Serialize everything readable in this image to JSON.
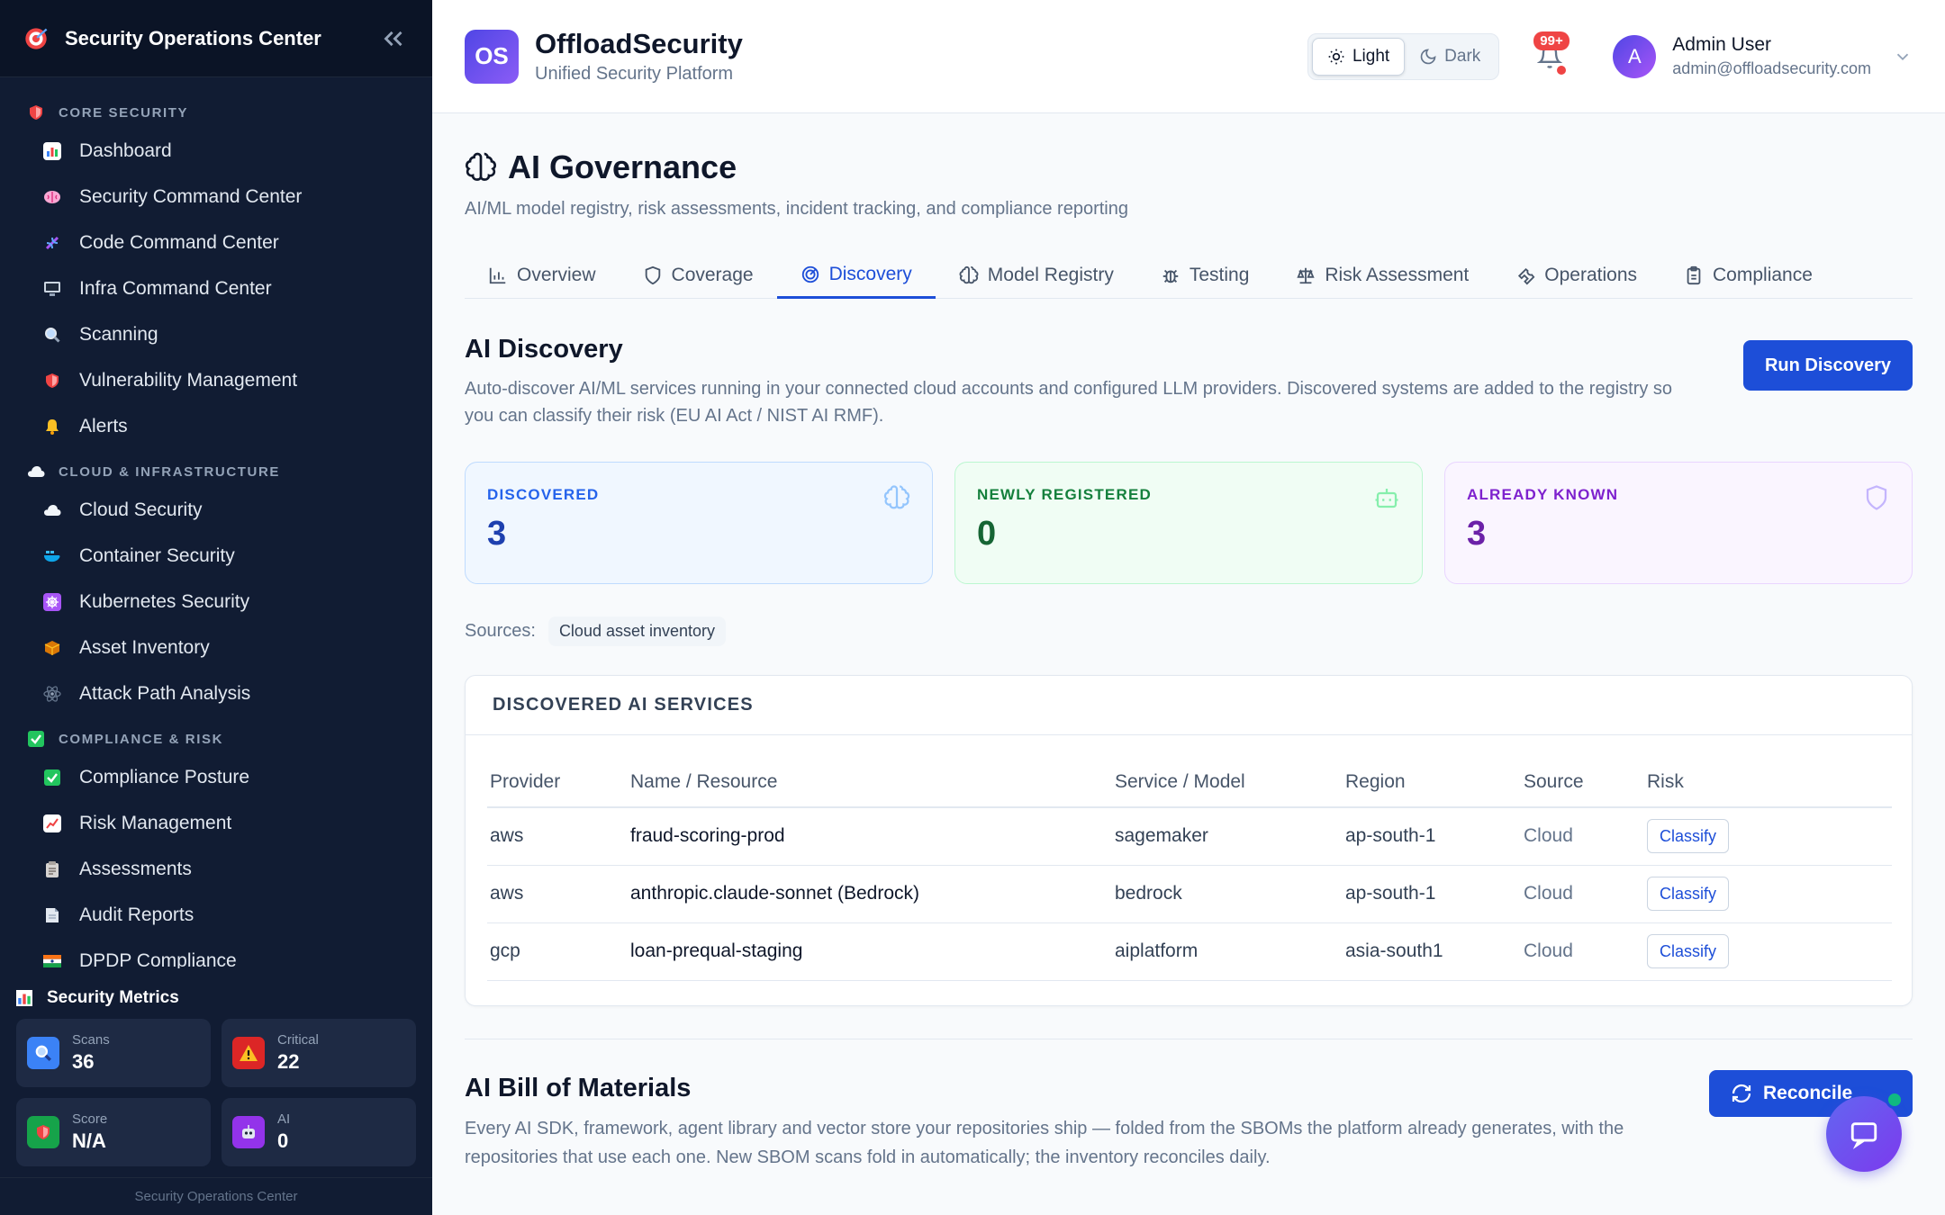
{
  "sidebar": {
    "title": "Security Operations Center",
    "sections": [
      {
        "label": "CORE SECURITY",
        "items": [
          "Dashboard",
          "Security Command Center",
          "Code Command Center",
          "Infra Command Center",
          "Scanning",
          "Vulnerability Management",
          "Alerts"
        ]
      },
      {
        "label": "CLOUD & INFRASTRUCTURE",
        "items": [
          "Cloud Security",
          "Container Security",
          "Kubernetes Security",
          "Asset Inventory",
          "Attack Path Analysis"
        ]
      },
      {
        "label": "COMPLIANCE & RISK",
        "items": [
          "Compliance Posture",
          "Risk Management",
          "Assessments",
          "Audit Reports",
          "DPDP Compliance"
        ]
      }
    ],
    "metrics": {
      "title": "Security Metrics",
      "cards": [
        {
          "label": "Scans",
          "value": "36"
        },
        {
          "label": "Critical",
          "value": "22"
        },
        {
          "label": "Score",
          "value": "N/A"
        },
        {
          "label": "AI",
          "value": "0"
        }
      ]
    },
    "footer": "Security Operations Center"
  },
  "header": {
    "logo": "OS",
    "brand": "OffloadSecurity",
    "subtitle": "Unified Security Platform",
    "theme": {
      "light": "Light",
      "dark": "Dark"
    },
    "notifications": "99+",
    "avatar": "A",
    "user_name": "Admin User",
    "user_email": "admin@offloadsecurity.com"
  },
  "page": {
    "title": "AI Governance",
    "description": "AI/ML model registry, risk assessments, incident tracking, and compliance reporting",
    "tabs": [
      "Overview",
      "Coverage",
      "Discovery",
      "Model Registry",
      "Testing",
      "Risk Assessment",
      "Operations",
      "Compliance"
    ],
    "active_tab": "Discovery"
  },
  "discovery": {
    "title": "AI Discovery",
    "description": "Auto-discover AI/ML services running in your connected cloud accounts and configured LLM providers. Discovered systems are added to the registry so you can classify their risk (EU AI Act / NIST AI RMF).",
    "run_button": "Run Discovery",
    "stats": [
      {
        "label": "DISCOVERED",
        "value": "3"
      },
      {
        "label": "NEWLY REGISTERED",
        "value": "0"
      },
      {
        "label": "ALREADY KNOWN",
        "value": "3"
      }
    ],
    "sources_label": "Sources:",
    "sources": [
      "Cloud asset inventory"
    ],
    "table": {
      "title": "DISCOVERED AI SERVICES",
      "columns": [
        "Provider",
        "Name / Resource",
        "Service / Model",
        "Region",
        "Source",
        "Risk"
      ],
      "rows": [
        {
          "provider": "aws",
          "name": "fraud-scoring-prod",
          "service": "sagemaker",
          "region": "ap-south-1",
          "source": "Cloud",
          "action": "Classify"
        },
        {
          "provider": "aws",
          "name": "anthropic.claude-sonnet (Bedrock)",
          "service": "bedrock",
          "region": "ap-south-1",
          "source": "Cloud",
          "action": "Classify"
        },
        {
          "provider": "gcp",
          "name": "loan-prequal-staging",
          "service": "aiplatform",
          "region": "asia-south1",
          "source": "Cloud",
          "action": "Classify"
        }
      ]
    }
  },
  "bom": {
    "title": "AI Bill of Materials",
    "description": "Every AI SDK, framework, agent library and vector store your repositories ship — folded from the SBOMs the platform already generates, with the repositories that use each one. New SBOM scans fold in automatically; the inventory reconciles daily.",
    "button": "Reconcile"
  },
  "colors": {
    "accent": "#1d4ed8",
    "sidebar_bg": "#111c33"
  }
}
